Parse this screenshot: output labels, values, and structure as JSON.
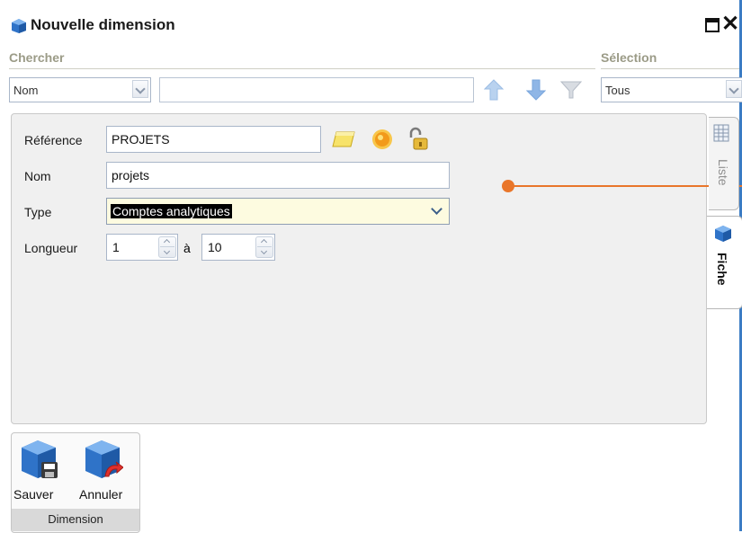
{
  "window": {
    "title": "Nouvelle dimension",
    "accent_color": "#3b7cc4"
  },
  "search": {
    "chercher_label": "Chercher",
    "selection_label": "Sélection",
    "field_combo_value": "Nom",
    "query_value": "",
    "selection_value": "Tous"
  },
  "form": {
    "reference_label": "Référence",
    "reference_value": "PROJETS",
    "nom_label": "Nom",
    "nom_value": "projets",
    "type_label": "Type",
    "type_value": "Comptes analytiques",
    "longueur_label": "Longueur",
    "longueur_min": "1",
    "a_label": "à",
    "longueur_max": "10"
  },
  "tabs": {
    "liste": "Liste",
    "fiche": "Fiche"
  },
  "toolbar": {
    "save_label": "Sauver",
    "cancel_label": "Annuler",
    "group_label": "Dimension"
  },
  "annotation_color": "#e9762a"
}
